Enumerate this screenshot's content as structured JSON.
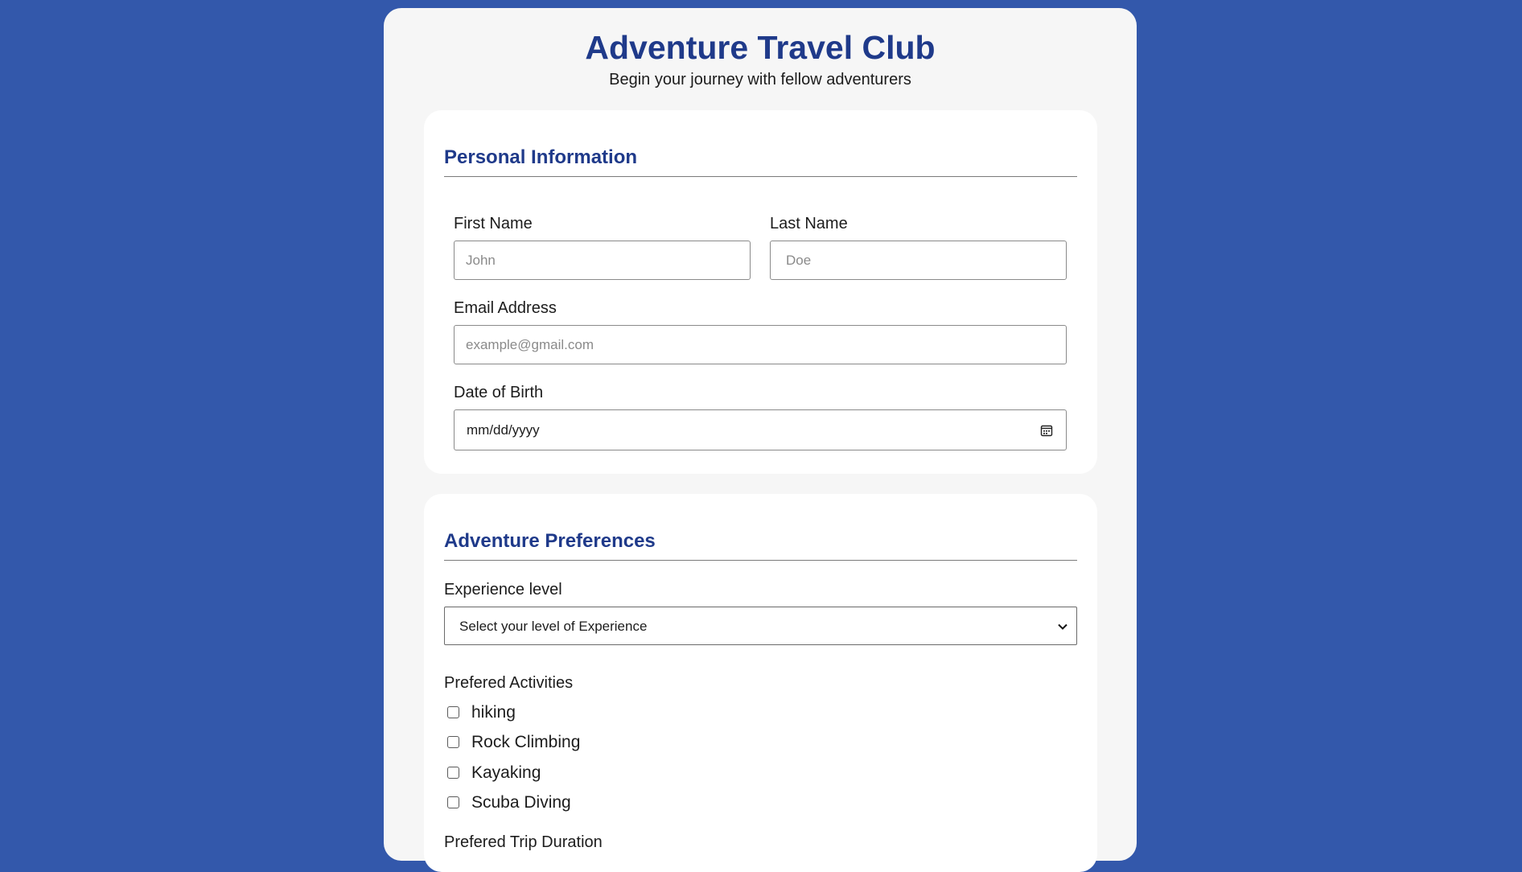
{
  "header": {
    "title": "Adventure Travel Club",
    "subtitle": "Begin your journey with fellow adventurers"
  },
  "personal": {
    "section_title": "Personal Information",
    "first_name": {
      "label": "First Name",
      "placeholder": "John"
    },
    "last_name": {
      "label": "Last Name",
      "placeholder": "Doe"
    },
    "email": {
      "label": "Email Address",
      "placeholder": "example@gmail.com"
    },
    "dob": {
      "label": "Date of Birth",
      "value": "mm/dd/yyyy",
      "icon": "calendar-icon"
    }
  },
  "preferences": {
    "section_title": "Adventure Preferences",
    "experience": {
      "label": "Experience level",
      "selected": "Select your level of Experience",
      "icon": "chevron-down-icon"
    },
    "activities_label": "Prefered Activities",
    "activities": [
      {
        "label": "hiking",
        "checked": false
      },
      {
        "label": "Rock Climbing",
        "checked": false
      },
      {
        "label": "Kayaking",
        "checked": false
      },
      {
        "label": "Scuba Diving",
        "checked": false
      }
    ],
    "duration_label": "Prefered Trip Duration"
  },
  "colors": {
    "page_background": "#3358ab",
    "accent": "#1f3a8a",
    "container": "#f6f6f6",
    "card": "#ffffff"
  }
}
